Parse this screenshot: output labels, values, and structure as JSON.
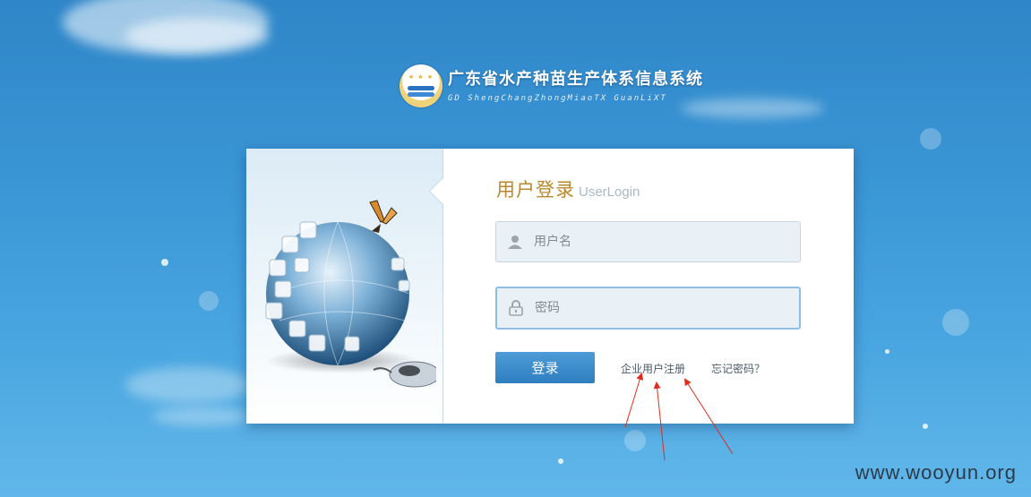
{
  "header": {
    "title_cn": "广东省水产种苗生产体系信息系统",
    "title_en": "GD ShengChangZhongMiaoTX GuanLiXT"
  },
  "login": {
    "title": "用户登录",
    "title_en": "UserLogin",
    "username_placeholder": "用户名",
    "password_placeholder": "密码",
    "submit_label": "登录",
    "register_link": "企业用户注册",
    "forgot_link": "忘记密码？"
  },
  "icons": {
    "user": "user-icon",
    "lock": "lock-icon",
    "logo": "emblem-logo",
    "illustration": "globe-puzzle-illustration"
  },
  "colors": {
    "background": "#3a95d5",
    "title_accent": "#b9882e",
    "button": "#3a8ccb",
    "annotation_arrow": "#e32b1c"
  },
  "watermark": "www.wooyun.org"
}
